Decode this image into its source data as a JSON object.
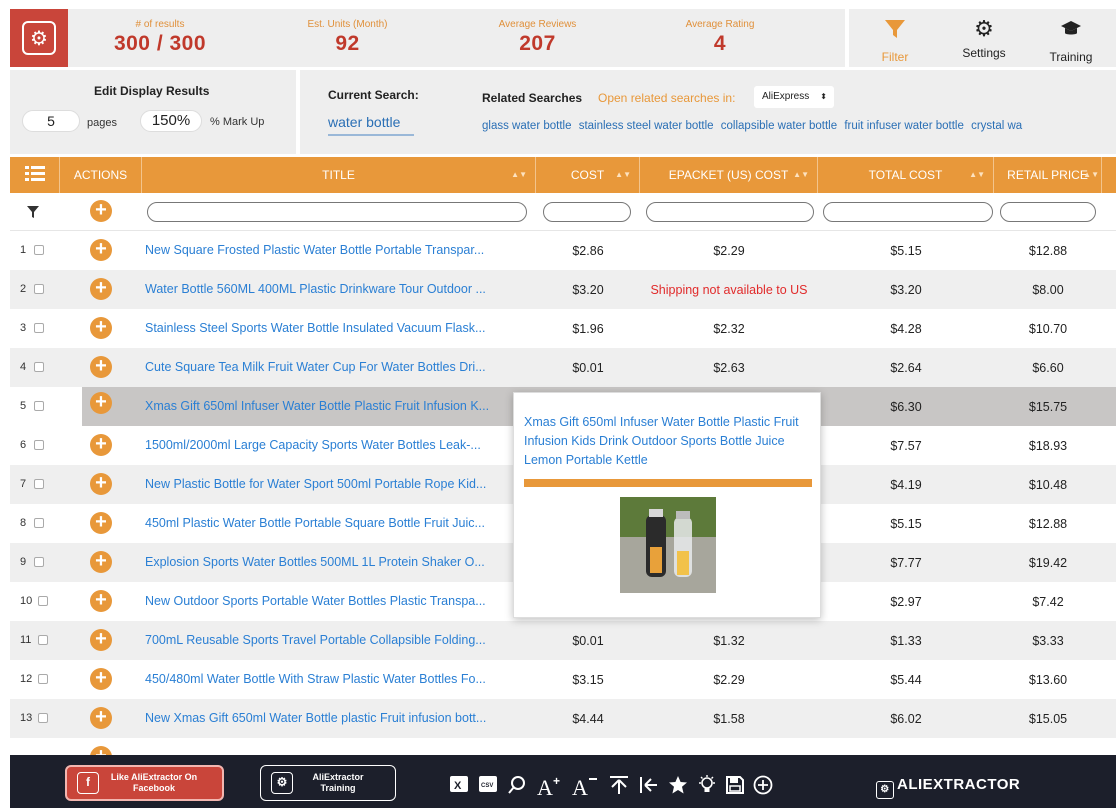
{
  "stats": {
    "results_label": "# of results",
    "results_value": "300 / 300",
    "units_label": "Est. Units (Month)",
    "units_value": "92",
    "reviews_label": "Average Reviews",
    "reviews_value": "207",
    "rating_label": "Average Rating",
    "rating_value": "4"
  },
  "tools": {
    "filter": "Filter",
    "settings": "Settings",
    "training": "Training"
  },
  "options": {
    "edit_title": "Edit Display Results",
    "pages_value": "5",
    "pages_label": "pages",
    "markup_value": "150%",
    "markup_label": "% Mark Up",
    "current_search_label": "Current Search:",
    "current_search_value": "water bottle",
    "related_label": "Related Searches",
    "related_open_label": "Open related searches in:",
    "related_select": "AliExpress",
    "related_links": [
      "glass water bottle",
      "stainless steel water bottle",
      "collapsible water bottle",
      "fruit infuser water bottle",
      "crystal wa"
    ]
  },
  "table": {
    "headers": {
      "actions": "ACTIONS",
      "title": "TITLE",
      "cost": "COST",
      "epacket": "EPACKET (US) COST",
      "total": "TOTAL COST",
      "retail": "RETAIL PRICE"
    },
    "rows": [
      {
        "n": "1",
        "title": "New Square Frosted Plastic Water Bottle Portable Transpar...",
        "cost": "$2.86",
        "epacket": "$2.29",
        "total": "$5.15",
        "retail": "$12.88"
      },
      {
        "n": "2",
        "title": "Water Bottle 560ML 400ML Plastic Drinkware Tour Outdoor ...",
        "cost": "$3.20",
        "epacket": "Shipping not available to US",
        "total": "$3.20",
        "retail": "$8.00"
      },
      {
        "n": "3",
        "title": "Stainless Steel Sports Water Bottle Insulated Vacuum Flask...",
        "cost": "$1.96",
        "epacket": "$2.32",
        "total": "$4.28",
        "retail": "$10.70"
      },
      {
        "n": "4",
        "title": "Cute Square Tea Milk Fruit Water Cup For Water Bottles Dri...",
        "cost": "$0.01",
        "epacket": "$2.63",
        "total": "$2.64",
        "retail": "$6.60"
      },
      {
        "n": "5",
        "title": "Xmas Gift 650ml Infuser Water Bottle Plastic Fruit Infusion K...",
        "cost": "",
        "epacket": "",
        "total": "$6.30",
        "retail": "$15.75"
      },
      {
        "n": "6",
        "title": "1500ml/2000ml Large Capacity Sports Water Bottles Leak-...",
        "cost": "",
        "epacket": "",
        "total": "$7.57",
        "retail": "$18.93"
      },
      {
        "n": "7",
        "title": "New Plastic Bottle for Water Sport 500ml Portable Rope Kid...",
        "cost": "",
        "epacket": "",
        "total": "$4.19",
        "retail": "$10.48"
      },
      {
        "n": "8",
        "title": "450ml Plastic Water Bottle Portable Square Bottle Fruit Juic...",
        "cost": "",
        "epacket": "",
        "total": "$5.15",
        "retail": "$12.88"
      },
      {
        "n": "9",
        "title": "Explosion Sports Water Bottles 500ML 1L Protein Shaker O...",
        "cost": "",
        "epacket": "",
        "total": "$7.77",
        "retail": "$19.42"
      },
      {
        "n": "10",
        "title": "New Outdoor Sports Portable Water Bottles Plastic Transpa...",
        "cost": "",
        "epacket": "",
        "total": "$2.97",
        "retail": "$7.42"
      },
      {
        "n": "11",
        "title": "700mL Reusable Sports Travel Portable Collapsible Folding...",
        "cost": "$0.01",
        "epacket": "$1.32",
        "total": "$1.33",
        "retail": "$3.33"
      },
      {
        "n": "12",
        "title": "450/480ml Water Bottle With Straw Plastic Water Bottles Fo...",
        "cost": "$3.15",
        "epacket": "$2.29",
        "total": "$5.44",
        "retail": "$13.60"
      },
      {
        "n": "13",
        "title": "New Xmas Gift 650ml Water Bottle plastic Fruit infusion bott...",
        "cost": "$4.44",
        "epacket": "$1.58",
        "total": "$6.02",
        "retail": "$15.05"
      }
    ]
  },
  "popup": {
    "title": "Xmas Gift 650ml Infuser Water Bottle Plastic Fruit Infusion Kids Drink Outdoor Sports Bottle Juice Lemon Portable Kettle"
  },
  "bottom": {
    "facebook_btn": "Like AliExtractor On Facebook",
    "training_btn": "AliExtractor Training",
    "brand": "ALIEXTRACTOR"
  },
  "colors": {
    "accent_orange": "#e8983a",
    "brand_red": "#c9453a",
    "link_blue": "#2a7fd4",
    "error_red": "#e12b2b",
    "toolbar_dark": "#1c1f2b"
  },
  "icons": [
    "logo-gear-icon",
    "filter-funnel-icon",
    "settings-gear-icon",
    "graduation-cap-icon",
    "list-icon",
    "filter-icon",
    "plus-circle-icon",
    "facebook-icon",
    "excel-icon",
    "csv-icon",
    "search-icon",
    "font-increase-icon",
    "font-decrease-icon",
    "scroll-top-icon",
    "collapse-left-icon",
    "star-icon",
    "lightbulb-icon",
    "save-icon",
    "add-circle-icon"
  ]
}
